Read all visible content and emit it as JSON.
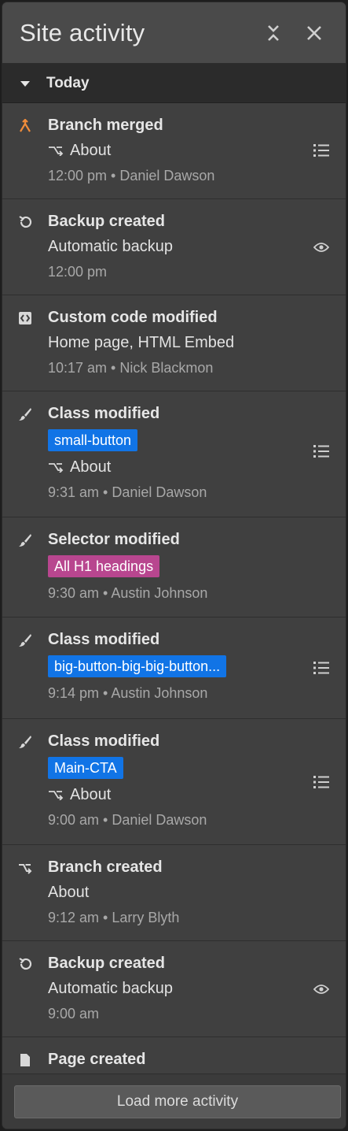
{
  "header": {
    "title": "Site activity"
  },
  "section": {
    "label": "Today"
  },
  "items": [
    {
      "title": "Branch merged",
      "branch": "About",
      "meta": "12:00 pm • Daniel Dawson"
    },
    {
      "title": "Backup created",
      "sub": "Automatic backup",
      "meta": "12:00 pm"
    },
    {
      "title": "Custom code modified",
      "sub": "Home page, HTML Embed",
      "meta": "10:17 am • Nick Blackmon"
    },
    {
      "title": "Class modified",
      "tag": "small-button",
      "branch": "About",
      "meta": "9:31 am • Daniel Dawson"
    },
    {
      "title": "Selector modified",
      "tag": "All H1 headings",
      "meta": "9:30 am • Austin Johnson"
    },
    {
      "title": "Class modified",
      "tag": "big-button-big-big-button...",
      "meta": "9:14 pm • Austin Johnson"
    },
    {
      "title": "Class modified",
      "tag": "Main-CTA",
      "branch": "About",
      "meta": "9:00 am • Daniel Dawson"
    },
    {
      "title": "Branch created",
      "sub": "About",
      "meta": "9:12 am • Larry Blyth"
    },
    {
      "title": "Backup created",
      "sub": "Automatic backup",
      "meta": "9:00 am"
    },
    {
      "title": "Page created"
    }
  ],
  "footer": {
    "load_more_label": "Load more activity"
  },
  "colors": {
    "merge_accent": "#f08c3a",
    "tag_blue": "#1174e6",
    "tag_pink": "#b8468f"
  }
}
